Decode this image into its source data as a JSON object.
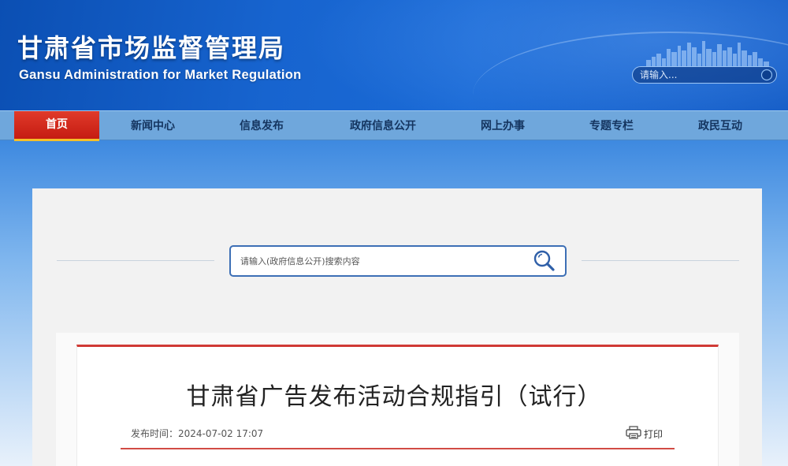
{
  "header": {
    "title_cn": "甘肃省市场监督管理局",
    "title_en": "Gansu Administration for Market Regulation",
    "search_placeholder": "请输入..."
  },
  "nav": {
    "items": [
      {
        "label": "首页",
        "active": true
      },
      {
        "label": "新闻中心",
        "active": false
      },
      {
        "label": "信息发布",
        "active": false
      },
      {
        "label": "政府信息公开",
        "active": false
      },
      {
        "label": "网上办事",
        "active": false
      },
      {
        "label": "专题专栏",
        "active": false
      },
      {
        "label": "政民互动",
        "active": false
      }
    ]
  },
  "main_search": {
    "placeholder": "请输入(政府信息公开)搜索内容"
  },
  "article": {
    "title": "甘肃省广告发布活动合规指引（试行）",
    "publish_label": "发布时间：",
    "publish_time": "2024-07-02 17:07",
    "print_label": "打印"
  },
  "colors": {
    "header_blue": "#1764cf",
    "nav_bg": "#6fa7dc",
    "nav_active": "#c51c12",
    "article_accent": "#d03a35",
    "search_border": "#3d6fb5"
  },
  "icons": {
    "header_search": "search-icon",
    "main_search": "magnifier-icon",
    "print": "printer-icon",
    "skyline": "city-skyline-icon"
  }
}
